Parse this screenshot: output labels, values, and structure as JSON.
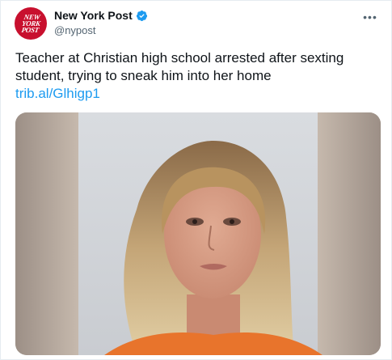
{
  "account": {
    "display_name": "New York Post",
    "handle": "@nypost",
    "avatar_text": [
      "NEW",
      "YORK",
      "POST"
    ],
    "verified": true,
    "brand_color": "#c8102e",
    "verified_color": "#1d9bf0"
  },
  "tweet": {
    "text": "Teacher at Christian high school arrested after sexting student, trying to sneak him into her home",
    "link": "trib.al/Glhigp1"
  },
  "icons": {
    "more": "more-options-icon",
    "verified": "verified-badge-icon"
  },
  "colors": {
    "text": "#0f1419",
    "secondary": "#536471",
    "link": "#1d9bf0"
  }
}
